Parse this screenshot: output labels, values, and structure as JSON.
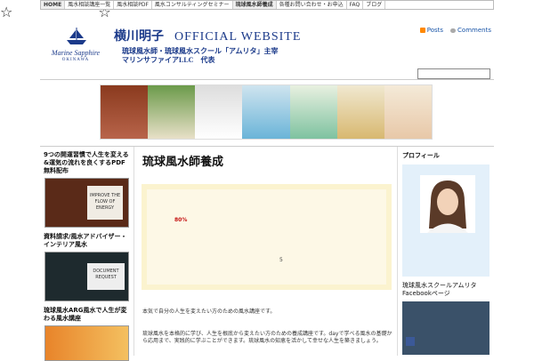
{
  "nav": {
    "items": [
      "HOME",
      "風水相談講座一覧",
      "風水相談PDF",
      "風水コンサルティングセミナー",
      "琉球風水師養成",
      "各種お問い合わせ・お申込",
      "FAQ",
      "ブログ"
    ]
  },
  "header": {
    "logo_line1": "Marine Sapphire",
    "logo_line2": "OKINAWA",
    "title_jp": "横川明子",
    "title_en": "OFFICIAL WEBSITE",
    "subtitle1": "琉球風水師・琉球風水スクール「アムリタ」主宰",
    "subtitle2": "マリンサファイアLLC　代表",
    "posts_label": "Posts",
    "comments_label": "Comments"
  },
  "left_sidebar": {
    "items": [
      {
        "title": "9つの開運習慣で人生を変える&運気の流れを良くするPDF無料配布"
      },
      {
        "title": "資料請求/風水アドバイザー・インテリア風水"
      },
      {
        "title": "琉球風水ARG風水で人生が変わる風水講座"
      }
    ],
    "img1_text": "IMPROVE THE FLOW OF ENERGY",
    "img2_text": "DOCUMENT REQUEST"
  },
  "main": {
    "title": "琉球風水師養成",
    "star_row": "☆　　　　　　☆",
    "percent": "80%",
    "five": "5",
    "para1": "本気で自分の人生を変えたい方のための風水講座です。",
    "para2": "琉球風水を本格的に学び、人生を根底から変えたい方のための養成講座です。dayで学べる風水の基礎から応用まで、実践的に学ぶことができます。琉球風水の知恵を活かして幸せな人生を築きましょう。"
  },
  "right_sidebar": {
    "profile_title": "プロフィール",
    "fb_title": "琉球風水スクールアムリタ Facebookページ"
  },
  "colors": {
    "accent": "#1b3a8a",
    "panel": "#fbf3cf",
    "pct": "#c41010"
  }
}
